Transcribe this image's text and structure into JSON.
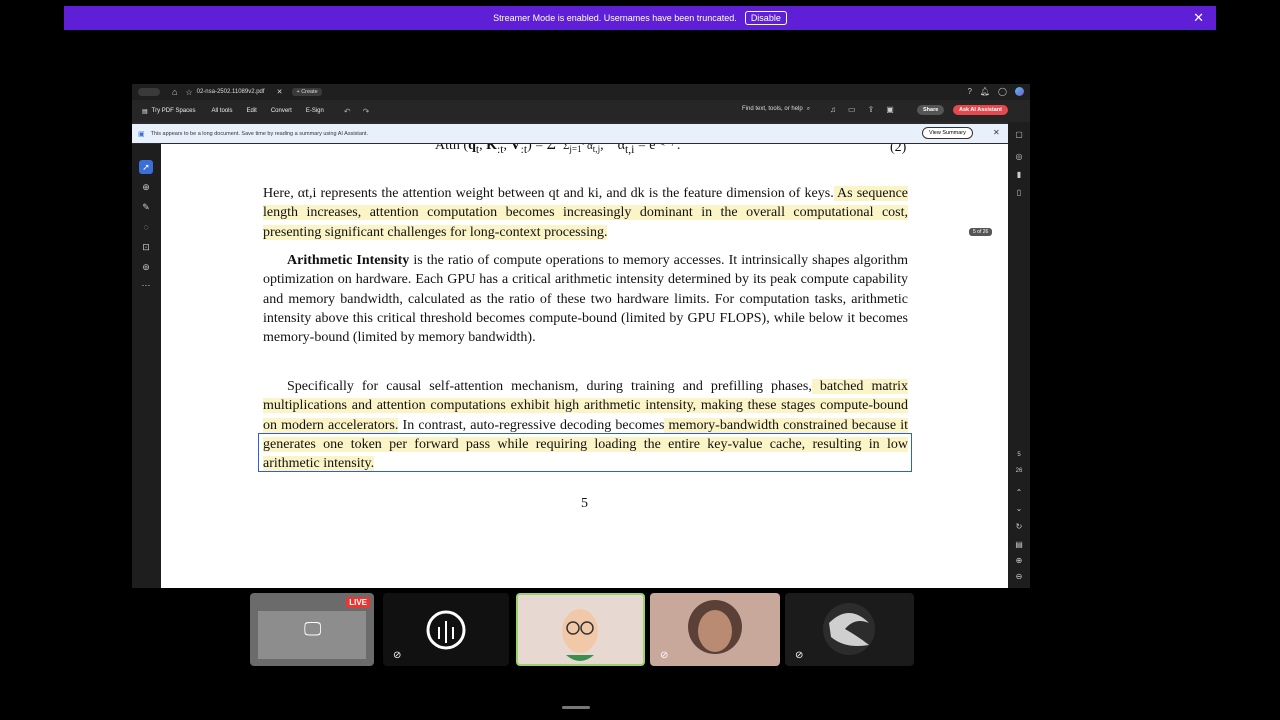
{
  "banner": {
    "message": "Streamer Mode is enabled. Usernames have been truncated.",
    "disable_label": "Disable"
  },
  "tabs": {
    "file_name": "02-nsa-2502.11089v2.pdf",
    "create_label": "Create"
  },
  "toolbar": {
    "spaces_label": "Try PDF Spaces",
    "menu": [
      "All tools",
      "Edit",
      "Convert",
      "E-Sign"
    ],
    "find_label": "Find text, tools, or help",
    "share_label": "Share",
    "ai_label": "Ask AI Assistant"
  },
  "notice": {
    "text": "This appears to be a long document. Save time by reading a summary using AI Assistant.",
    "view_summary_label": "View Summary"
  },
  "page_indicator": "5 of 26",
  "rail": {
    "page_current": "5",
    "page_total": "26"
  },
  "document": {
    "equation": "Attn (qt, K:t, V:t) = Σ αt,i / Σ αt,j ,   αt,i = e^{qt·ki}.",
    "eq_number": "(2)",
    "p1_plain": "Here, αt,i represents the attention weight between qt and ki, and dk is the feature dimension of keys.",
    "p1_highlight": " As sequence length increases, attention computation becomes increasingly dominant in the overall computational cost, presenting significant challenges for long-context processing.",
    "p2_bold": "Arithmetic Intensity",
    "p2_text": " is the ratio of compute operations to memory accesses. It intrinsically shapes algorithm optimization on hardware.  Each GPU has a critical arithmetic intensity determined by its peak compute capability and memory bandwidth, calculated as the ratio of these two hardware limits. For computation tasks, arithmetic intensity above this critical threshold becomes compute-bound (limited by GPU FLOPS), while below it becomes memory-bound (limited by memory bandwidth).",
    "p3_plain": "Specifically for causal self-attention mechanism, during training and prefilling phases,",
    "p3_highlight": " batched matrix multiplications and attention computations exhibit high arithmetic intensity, making these stages compute-bound on modern accelerators.",
    "p3_plain2": " In contrast, auto-regressive decoding becomes",
    "p3_highlight2": " memory-bandwidth constrained because it generates one token per forward pass while requiring loading the entire key-value cache, resulting in low arithmetic intensity.",
    "page_number": "5"
  },
  "video": {
    "live_label": "LIVE"
  }
}
